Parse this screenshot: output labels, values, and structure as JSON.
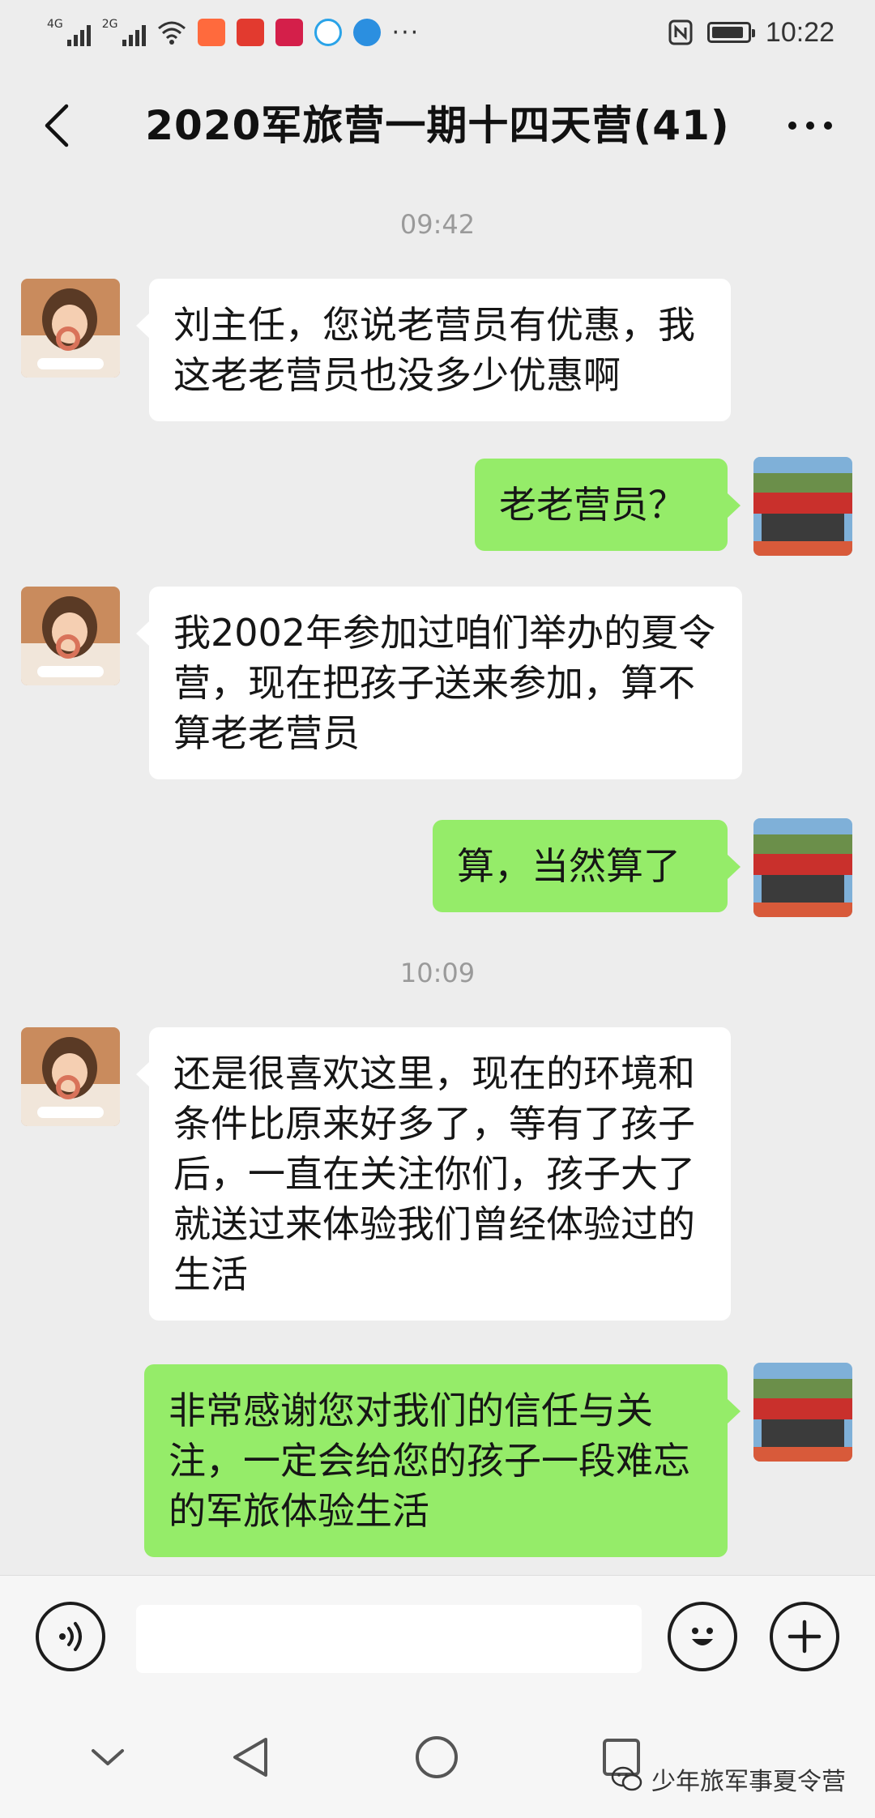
{
  "status_bar": {
    "time": "10:22",
    "network_1": "4G",
    "network_2": "2G"
  },
  "header": {
    "title": "2020军旅营一期十四天营(41)"
  },
  "messages": [
    {
      "type": "timestamp",
      "text": "09:42"
    },
    {
      "type": "message",
      "side": "left",
      "text": "刘主任，您说老营员有优惠，我这老老营员也没多少优惠啊"
    },
    {
      "type": "message",
      "side": "right",
      "text": "老老营员？"
    },
    {
      "type": "message",
      "side": "left",
      "text": "我2002年参加过咱们举办的夏令营，现在把孩子送来参加，算不算老老营员"
    },
    {
      "type": "message",
      "side": "right",
      "text": "算，当然算了"
    },
    {
      "type": "timestamp",
      "text": "10:09"
    },
    {
      "type": "message",
      "side": "left",
      "text": "还是很喜欢这里，现在的环境和条件比原来好多了，等有了孩子后，一直在关注你们，孩子大了就送过来体验我们曾经体验过的生活"
    },
    {
      "type": "message",
      "side": "right",
      "text": "非常感谢您对我们的信任与关注，一定会给您的孩子一段难忘的军旅体验生活"
    }
  ],
  "icons": {
    "back": "chevron-left-icon",
    "more": "more-dots-icon",
    "voice": "voice-icon",
    "emoji": "emoji-icon",
    "plus": "plus-icon"
  },
  "colors": {
    "sent_bubble": "#95ec69",
    "received_bubble": "#ffffff",
    "chat_background": "#ededed"
  },
  "watermark": "少年旅军事夏令营"
}
